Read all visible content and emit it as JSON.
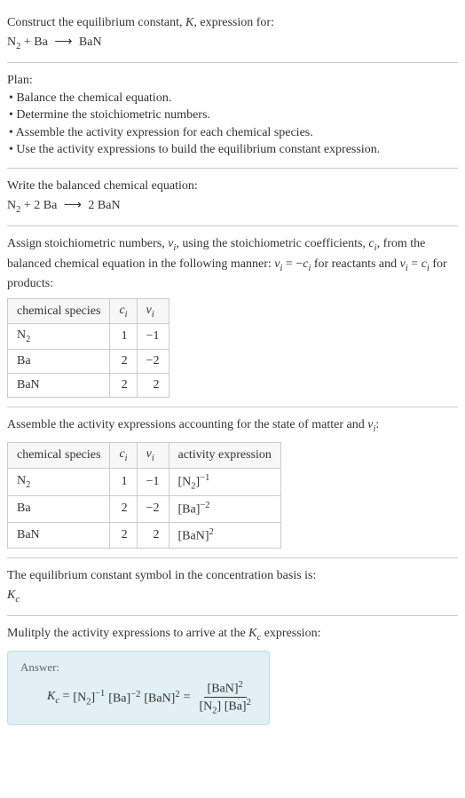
{
  "header": {
    "intro": "Construct the equilibrium constant, ",
    "K_var": "K",
    "intro2": ", expression for:",
    "equation_lhs": "N",
    "equation_lhs_sub": "2",
    "equation_plus": " + Ba ",
    "arrow": "⟶",
    "equation_rhs": " BaN"
  },
  "plan": {
    "title": "Plan:",
    "b1": "• Balance the chemical equation.",
    "b2": "• Determine the stoichiometric numbers.",
    "b3": "• Assemble the activity expression for each chemical species.",
    "b4": "• Use the activity expressions to build the equilibrium constant expression."
  },
  "balanced": {
    "title": "Write the balanced chemical equation:",
    "lhs1": "N",
    "lhs1_sub": "2",
    "plus": " + 2 Ba ",
    "arrow": "⟶",
    "rhs": " 2 BaN"
  },
  "stoich": {
    "intro1": "Assign stoichiometric numbers, ",
    "nu_i": "ν",
    "nu_i_sub": "i",
    "intro2": ", using the stoichiometric coefficients, ",
    "c_i": "c",
    "c_i_sub": "i",
    "intro3": ", from the balanced chemical equation in the following manner: ",
    "rel1_lhs": "ν",
    "rel1_lhs_sub": "i",
    "rel1_eq": " = −",
    "rel1_rhs": "c",
    "rel1_rhs_sub": "i",
    "intro4": " for reactants and ",
    "rel2_lhs": "ν",
    "rel2_lhs_sub": "i",
    "rel2_eq": " = ",
    "rel2_rhs": "c",
    "rel2_rhs_sub": "i",
    "intro5": " for products:",
    "headers": {
      "h1": "chemical species",
      "h2": "c",
      "h2_sub": "i",
      "h3": "ν",
      "h3_sub": "i"
    },
    "rows": [
      {
        "species": "N",
        "species_sub": "2",
        "c": "1",
        "nu": "−1"
      },
      {
        "species": "Ba",
        "species_sub": "",
        "c": "2",
        "nu": "−2"
      },
      {
        "species": "BaN",
        "species_sub": "",
        "c": "2",
        "nu": "2"
      }
    ]
  },
  "activity": {
    "title1": "Assemble the activity expressions accounting for the state of matter and ",
    "nu": "ν",
    "nu_sub": "i",
    "title2": ":",
    "headers": {
      "h1": "chemical species",
      "h2": "c",
      "h2_sub": "i",
      "h3": "ν",
      "h3_sub": "i",
      "h4": "activity expression"
    },
    "rows": [
      {
        "species": "N",
        "species_sub": "2",
        "c": "1",
        "nu": "−1",
        "act_base": "[N",
        "act_base_sub": "2",
        "act_close": "]",
        "act_exp": "−1"
      },
      {
        "species": "Ba",
        "species_sub": "",
        "c": "2",
        "nu": "−2",
        "act_base": "[Ba",
        "act_base_sub": "",
        "act_close": "]",
        "act_exp": "−2"
      },
      {
        "species": "BaN",
        "species_sub": "",
        "c": "2",
        "nu": "2",
        "act_base": "[BaN",
        "act_base_sub": "",
        "act_close": "]",
        "act_exp": "2"
      }
    ]
  },
  "symbol": {
    "title": "The equilibrium constant symbol in the concentration basis is:",
    "K": "K",
    "K_sub": "c"
  },
  "multiply": {
    "title": "Mulitply the activity expressions to arrive at the ",
    "K": "K",
    "K_sub": "c",
    "title2": " expression:"
  },
  "answer": {
    "label": "Answer:",
    "Kc": "K",
    "Kc_sub": "c",
    "eq": " = ",
    "t1": "[N",
    "t1_sub": "2",
    "t1_close": "]",
    "t1_exp": "−1",
    "t2": " [Ba]",
    "t2_exp": "−2",
    "t3": " [BaN]",
    "t3_exp": "2",
    "eq2": " = ",
    "num": "[BaN]",
    "num_exp": "2",
    "den1": "[N",
    "den1_sub": "2",
    "den1_close": "] [Ba]",
    "den_exp": "2"
  },
  "chart_data": {
    "type": "table",
    "tables": [
      {
        "title": "Stoichiometric numbers",
        "columns": [
          "chemical species",
          "c_i",
          "ν_i"
        ],
        "rows": [
          [
            "N2",
            1,
            -1
          ],
          [
            "Ba",
            2,
            -2
          ],
          [
            "BaN",
            2,
            2
          ]
        ]
      },
      {
        "title": "Activity expressions",
        "columns": [
          "chemical species",
          "c_i",
          "ν_i",
          "activity expression"
        ],
        "rows": [
          [
            "N2",
            1,
            -1,
            "[N2]^-1"
          ],
          [
            "Ba",
            2,
            -2,
            "[Ba]^-2"
          ],
          [
            "BaN",
            2,
            2,
            "[BaN]^2"
          ]
        ]
      }
    ]
  }
}
